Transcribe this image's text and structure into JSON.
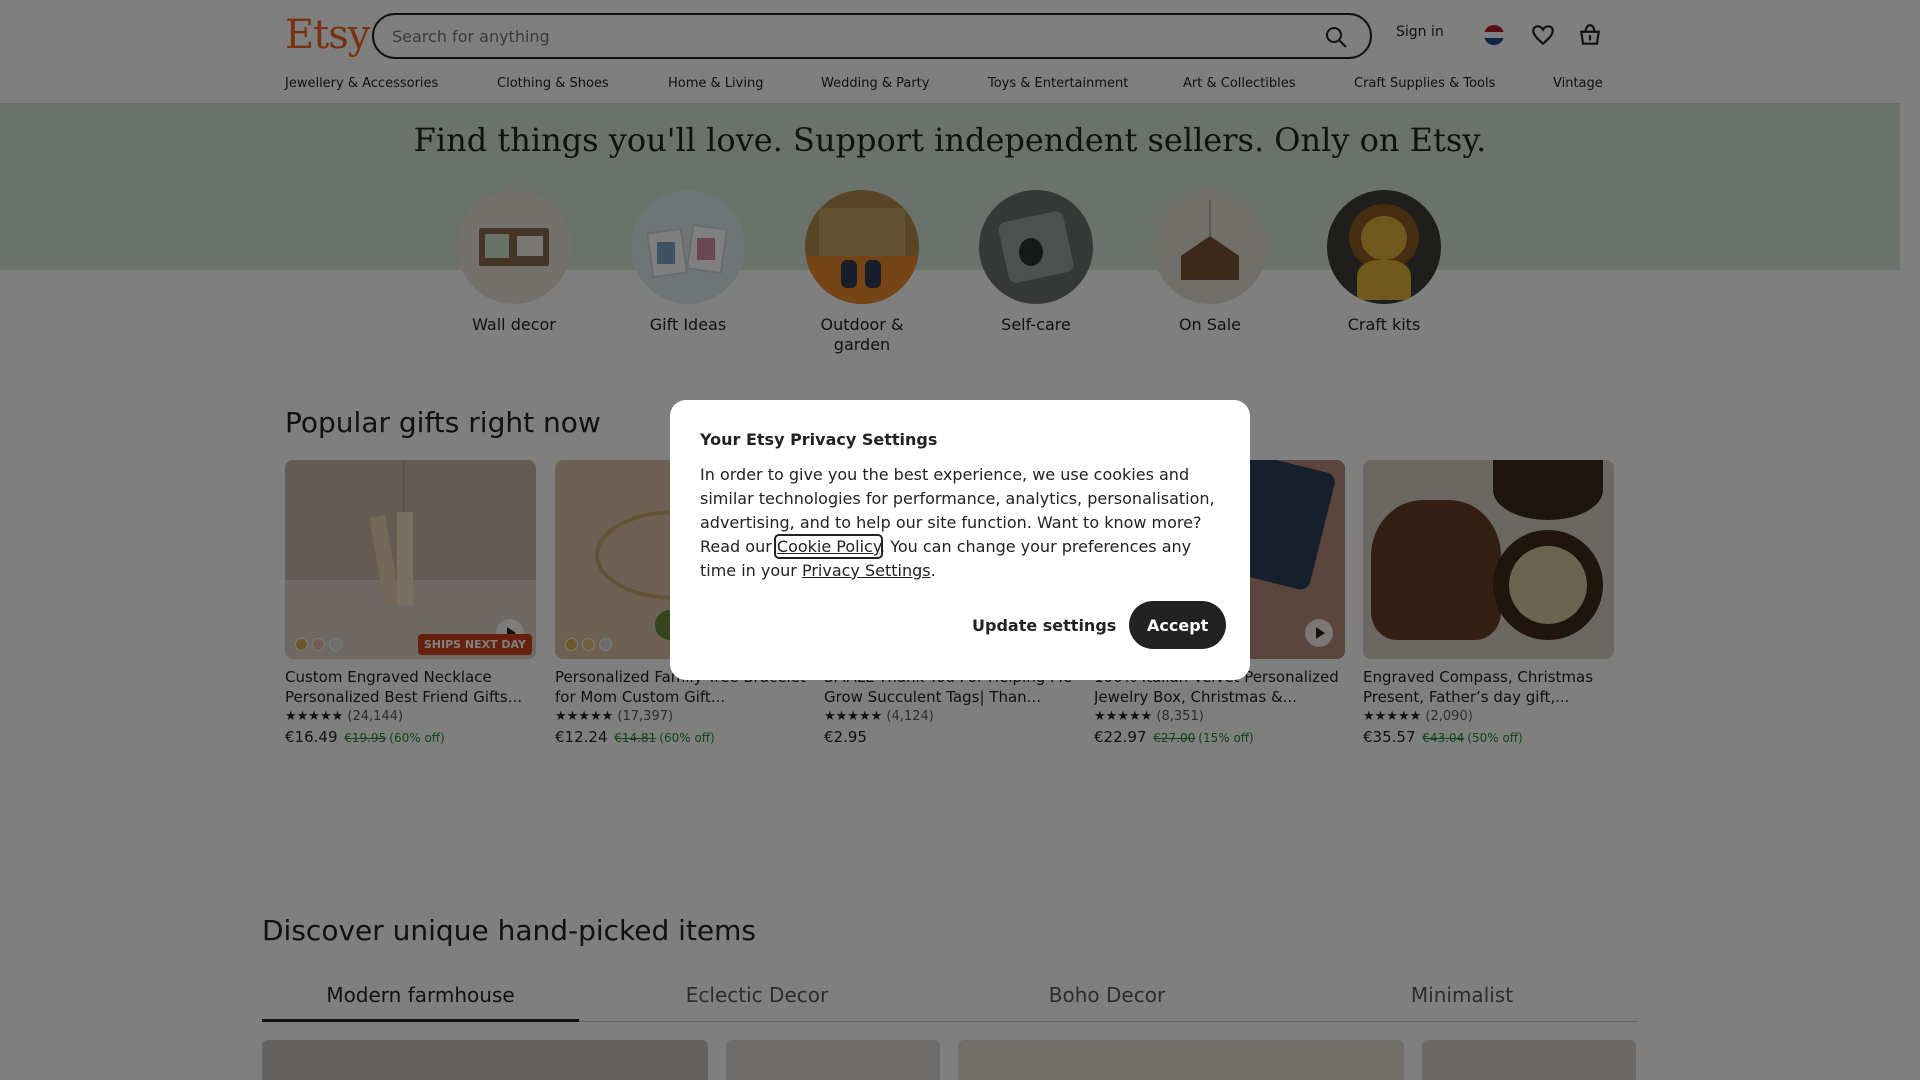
{
  "header": {
    "logo": "Etsy",
    "search_placeholder": "Search for anything",
    "signin_label": "Sign in",
    "icons": [
      "search-icon",
      "flag-icon",
      "heart-icon",
      "basket-icon"
    ]
  },
  "nav": {
    "items": [
      "Jewellery & Accessories",
      "Clothing & Shoes",
      "Home & Living",
      "Wedding & Party",
      "Toys & Entertainment",
      "Art & Collectibles",
      "Craft Supplies & Tools",
      "Vintage"
    ]
  },
  "hero": {
    "title": "Find things you'll love. Support independent sellers. Only on Etsy.",
    "categories": [
      {
        "label": "Wall decor"
      },
      {
        "label": "Gift Ideas"
      },
      {
        "label": "Outdoor & garden"
      },
      {
        "label": "Self-care"
      },
      {
        "label": "On Sale"
      },
      {
        "label": "Craft kits"
      }
    ]
  },
  "popular": {
    "title": "Popular gifts right now",
    "products": [
      {
        "title": "Custom Engraved Necklace Personalized Best Friend Gifts...",
        "stars": "★★★★★",
        "reviews": "(24,144)",
        "price": "€16.49",
        "original": "€19.95",
        "discount": "(60% off)",
        "badge": "SHIPS NEXT DAY"
      },
      {
        "title": "Personalized Family Tree Bracelet for Mom Custom Gift...",
        "stars": "★★★★★",
        "reviews": "(17,397)",
        "price": "€12.24",
        "original": "€14.81",
        "discount": "(60% off)",
        "badge": ""
      },
      {
        "title": "SMALL Thank You For Helping Me Grow Succulent Tags| Than...",
        "stars": "★★★★★",
        "reviews": "(4,124)",
        "price": "€2.95",
        "original": "",
        "discount": "",
        "badge": ""
      },
      {
        "title": "100% Italian Velvet Personalized Jewelry Box, Christmas &...",
        "stars": "★★★★★",
        "reviews": "(8,351)",
        "price": "€22.97",
        "original": "€27.00",
        "discount": "(15% off)",
        "badge": ""
      },
      {
        "title": "Engraved Compass, Christmas Present, Father’s day gift,...",
        "stars": "★★★★★",
        "reviews": "(2,090)",
        "price": "€35.57",
        "original": "€43.04",
        "discount": "(50% off)",
        "badge": ""
      }
    ]
  },
  "discover": {
    "title": "Discover unique hand-picked items",
    "tabs": [
      "Modern farmhouse",
      "Eclectic Decor",
      "Boho Decor",
      "Minimalist"
    ]
  },
  "privacy_modal": {
    "title": "Your Etsy Privacy Settings",
    "body_1": "In order to give you the best experience, we use cookies and similar technologies for performance, analytics, personalisation, advertising, and to help our site function. Want to know more? Read our ",
    "cookie_link": "Cookie Policy",
    "body_2": ". You can change your preferences any time in your ",
    "privacy_link": "Privacy Settings",
    "body_3": ".",
    "update_label": "Update settings",
    "accept_label": "Accept"
  },
  "colors": {
    "brand": "#f1641e",
    "hero_band": "#d5e5d6",
    "sale_green": "#258635",
    "overlay": "rgba(0,0,0,0.5)"
  }
}
